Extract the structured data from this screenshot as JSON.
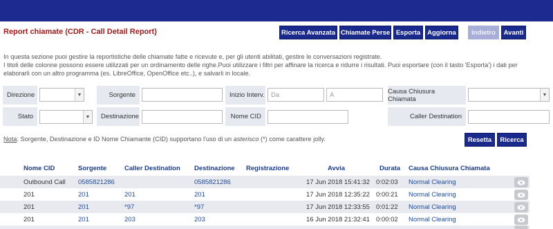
{
  "header": {
    "title": "Report chiamate (CDR - Call Detail Report)",
    "buttons": {
      "advanced_search": "Ricerca Avanzata",
      "missed_calls": "Chiamate Perse",
      "export": "Esporta",
      "refresh": "Aggiorna",
      "back": "Indietro",
      "forward": "Avanti"
    }
  },
  "intro": {
    "line1": "In questa sezione puoi gestire la reportistiche delle chiamate fatte e ricevute e, per gli utenti abilitati, gestire le conversazioni registrate.",
    "line2": "I titoli delle colonne possono essere utilizzati per un ordinamento delle righe.Puoi utilizzare i filtri per affinare la ricerca e ridurre i risultati. Puoi esportare (con il tasto 'Esporta') i dati per elaborarli con un altro programma (es. LibreOffice, OpenOffice etc..), e salvarli in locale."
  },
  "filters": {
    "direction_label": "Direzione",
    "source_label": "Sorgente",
    "start_label": "Inizio Interv.",
    "start_from_placeholder": "Da",
    "start_to_placeholder": "A",
    "hangup_cause_label": "Causa Chiusura Chiamata",
    "status_label": "Stato",
    "destination_label": "Destinazione",
    "cid_name_label": "Nome CID",
    "caller_destination_label": "Caller Destination"
  },
  "note": {
    "prefix": "Nota",
    "text_before": ": Sorgente, Destinazione e ID Nome Chiamante (CID) supportano l'uso di un ",
    "emphasis": "asterisco",
    "text_after": " (*) come carattere jolly."
  },
  "actions": {
    "reset": "Resetta",
    "search": "Ricerca"
  },
  "table": {
    "columns": [
      "Nome CID",
      "Sorgente",
      "Caller Destination",
      "Destinazione",
      "Registrazione",
      "Avvia",
      "Durata",
      "Causa Chiusura Chiamata"
    ],
    "rows": [
      {
        "cid_name": "Outbound Call",
        "source": "0585821286",
        "caller_destination": "",
        "destination": "0585821286",
        "recording": "",
        "start": "17 Jun 2018 15:41:32",
        "duration": "0:02:03",
        "cause": "Normal Clearing"
      },
      {
        "cid_name": "201",
        "source": "201",
        "caller_destination": "201",
        "destination": "201",
        "recording": "",
        "start": "17 Jun 2018 12:35:22",
        "duration": "0:00:21",
        "cause": "Normal Clearing"
      },
      {
        "cid_name": "201",
        "source": "201",
        "caller_destination": "*97",
        "destination": "*97",
        "recording": "",
        "start": "17 Jun 2018 12:33:55",
        "duration": "0:01:22",
        "cause": "Normal Clearing"
      },
      {
        "cid_name": "201",
        "source": "201",
        "caller_destination": "203",
        "destination": "203",
        "recording": "",
        "start": "16 Jun 2018 21:32:41",
        "duration": "0:00:02",
        "cause": "Normal Clearing"
      }
    ]
  }
}
